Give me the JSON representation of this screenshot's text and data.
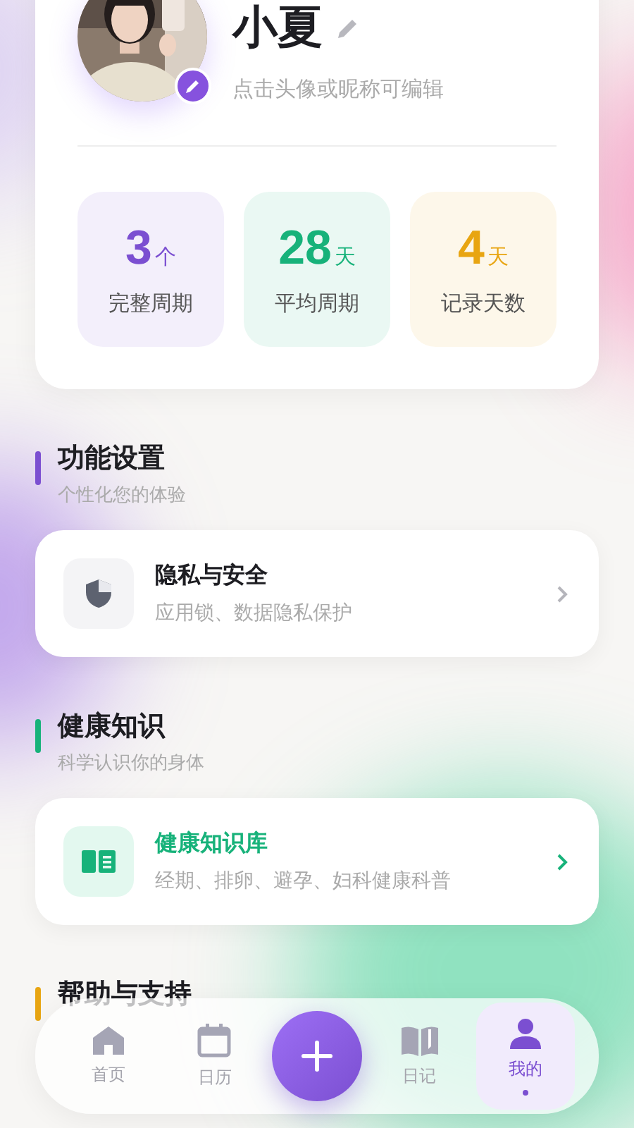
{
  "profile": {
    "name": "小夏",
    "hint": "点击头像或昵称可编辑"
  },
  "stats": [
    {
      "value": "3",
      "unit": "个",
      "label": "完整周期",
      "color": "#7b4fd1"
    },
    {
      "value": "28",
      "unit": "天",
      "label": "平均周期",
      "color": "#17b27a"
    },
    {
      "value": "4",
      "unit": "天",
      "label": "记录天数",
      "color": "#e8a512"
    }
  ],
  "sections": [
    {
      "title": "功能设置",
      "subtitle": "个性化您的体验",
      "color": "#7b4fd1",
      "items": [
        {
          "kind": "shield",
          "title": "隐私与安全",
          "desc": "应用锁、数据隐私保护",
          "highlighted": false
        }
      ]
    },
    {
      "title": "健康知识",
      "subtitle": "科学认识你的身体",
      "color": "#17b27a",
      "items": [
        {
          "kind": "book",
          "title": "健康知识库",
          "desc": "经期、排卵、避孕、妇科健康科普",
          "highlighted": true
        }
      ]
    },
    {
      "title": "帮助与支持",
      "color": "#e8a512"
    }
  ],
  "nav": [
    {
      "kind": "home",
      "label": "首页",
      "selected": false
    },
    {
      "kind": "calendar",
      "label": "日历",
      "selected": false
    },
    {
      "kind": "add",
      "selected": false
    },
    {
      "kind": "diary",
      "label": "日记",
      "selected": false
    },
    {
      "kind": "me",
      "label": "我的",
      "selected": true
    }
  ]
}
